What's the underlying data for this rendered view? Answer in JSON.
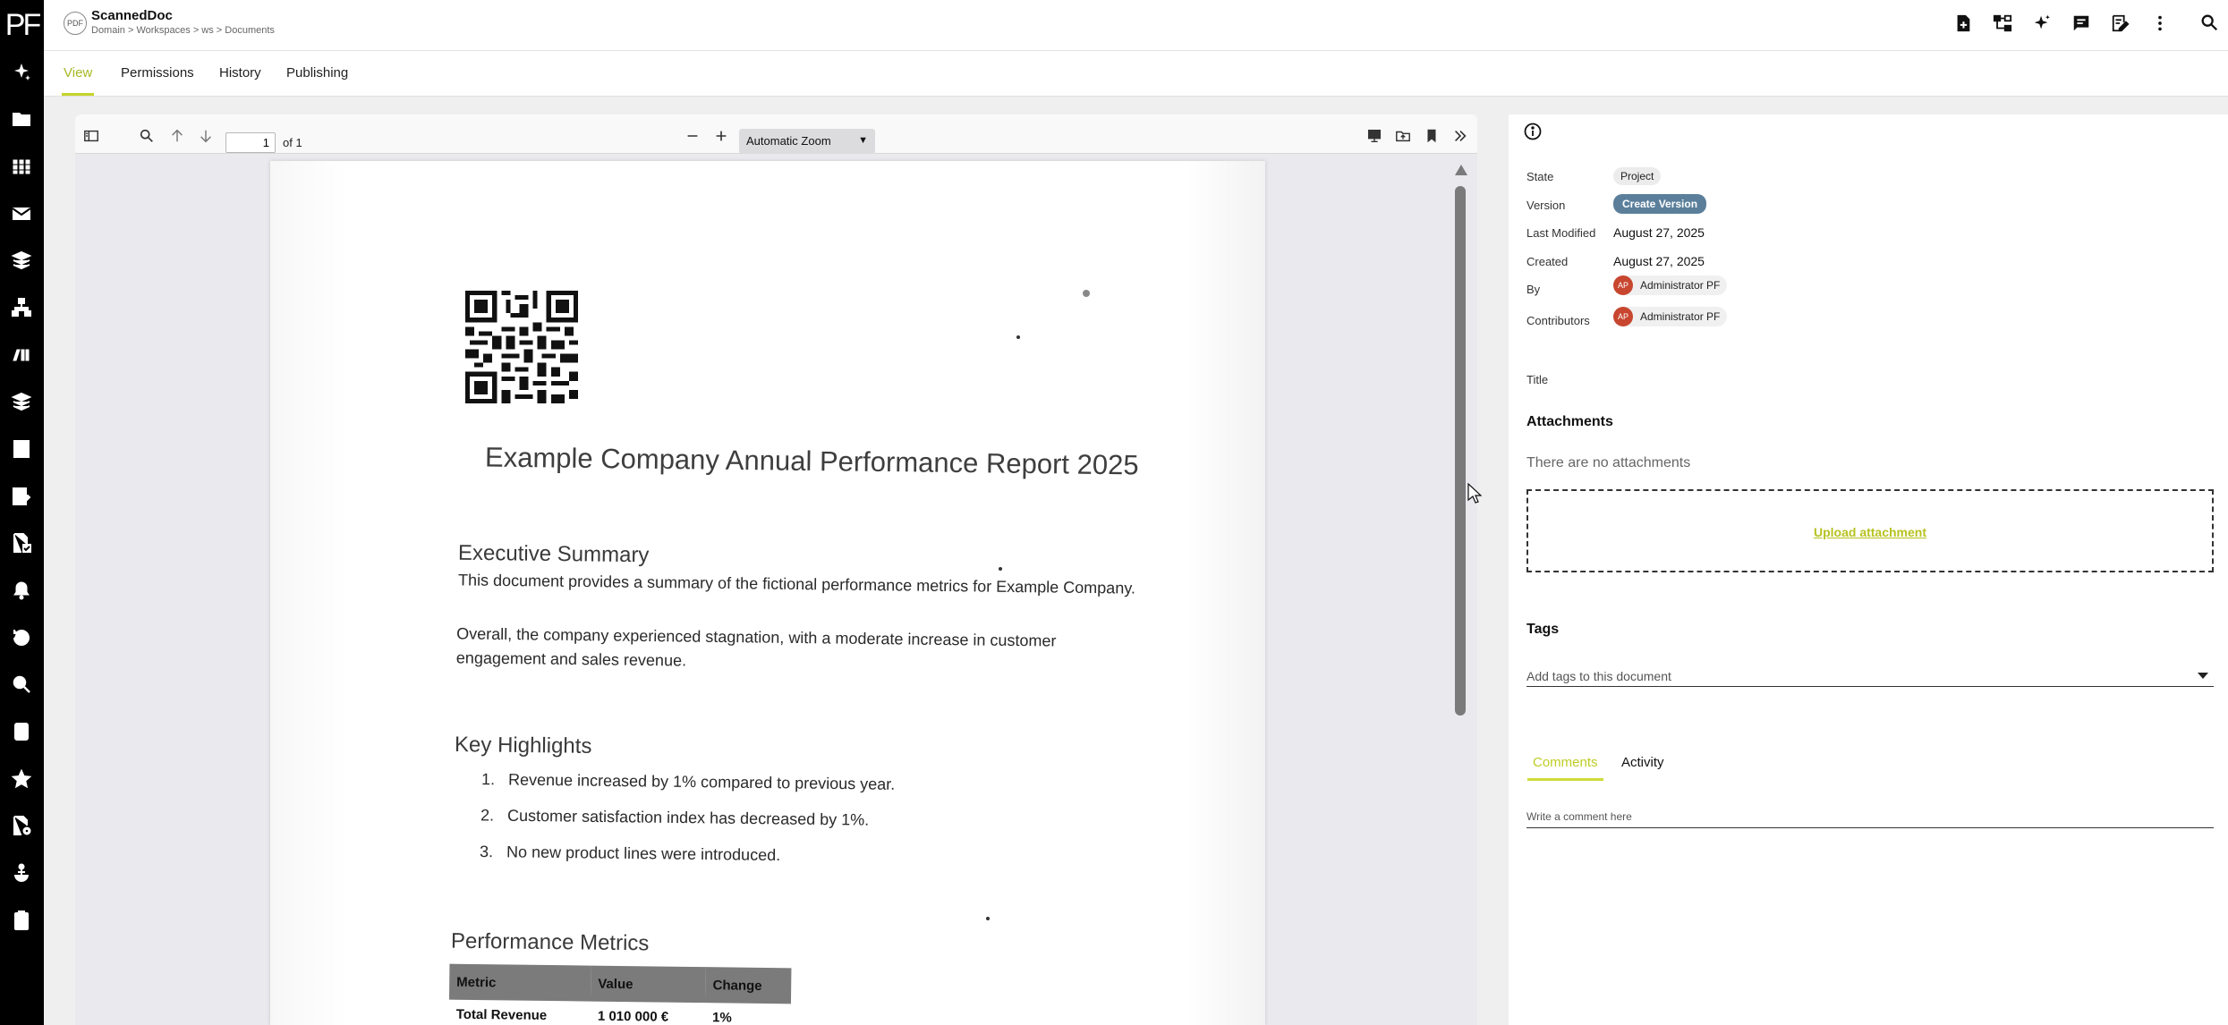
{
  "app": {
    "logo_text": "PF"
  },
  "header": {
    "doc_badge": "PDF",
    "title": "ScannedDoc",
    "breadcrumb": "Domain > Workspaces > ws > Documents",
    "actions": [
      "add-document-icon",
      "hierarchy-icon",
      "sparkle-icon",
      "comment-icon",
      "edit-note-icon",
      "more-vertical-icon"
    ],
    "search_icon": "search-icon"
  },
  "tabs": [
    {
      "label": "View",
      "active": true
    },
    {
      "label": "Permissions",
      "active": false
    },
    {
      "label": "History",
      "active": false
    },
    {
      "label": "Publishing",
      "active": false
    }
  ],
  "sidebar_icons": [
    "sparkle-icon",
    "folder-icon",
    "apps-grid-icon",
    "mail-icon",
    "box-stack-icon",
    "org-chart-icon",
    "workflow-icon",
    "box-stack-2-icon",
    "document-list-icon",
    "edit-document-icon",
    "document-check-icon",
    "notification-icon",
    "history-icon",
    "search-icon",
    "task-check-icon",
    "star-icon",
    "document-settings-icon",
    "anchor-icon",
    "clipboard-icon"
  ],
  "viewer": {
    "page_value": "1",
    "page_of": "of 1",
    "zoom": "Automatic Zoom"
  },
  "pdf": {
    "title": "Example Company Annual Performance Report 2025",
    "exec_heading": "Executive Summary",
    "exec_p1": "This document provides a summary of the fictional performance metrics for Example Company.",
    "exec_p2": "Overall, the company experienced stagnation, with a moderate increase in customer engagement and sales revenue.",
    "highlights_heading": "Key Highlights",
    "highlights": [
      {
        "num": "1.",
        "text": "Revenue increased by 1% compared to previous year."
      },
      {
        "num": "2.",
        "text": "Customer satisfaction index has decreased by 1%."
      },
      {
        "num": "3.",
        "text": "No new product lines were introduced."
      }
    ],
    "metrics_heading": "Performance Metrics",
    "table_headers": [
      "Metric",
      "Value",
      "Change"
    ],
    "table_rows": [
      [
        "Total Revenue",
        "1 010 000 €",
        "1%"
      ]
    ]
  },
  "side": {
    "state_label": "State",
    "state_value": "Project",
    "version_label": "Version",
    "version_button": "Create Version",
    "modified_label": "Last Modified",
    "modified_value": "August 27, 2025",
    "created_label": "Created",
    "created_value": "August 27, 2025",
    "by_label": "By",
    "by_initials": "AP",
    "by_name": "Administrator PF",
    "contrib_label": "Contributors",
    "contrib_initials": "AP",
    "contrib_name": "Administrator PF",
    "title_label": "Title",
    "attachments_heading": "Attachments",
    "no_attachments": "There are no attachments",
    "upload_label": "Upload attachment",
    "tags_heading": "Tags",
    "tags_placeholder": "Add tags to this document",
    "comments_tab": "Comments",
    "activity_tab": "Activity",
    "comment_placeholder": "Write a comment here"
  },
  "colors": {
    "accent": "#c5d42a",
    "version_chip": "#5b7f9b",
    "avatar": "#c8462f"
  }
}
